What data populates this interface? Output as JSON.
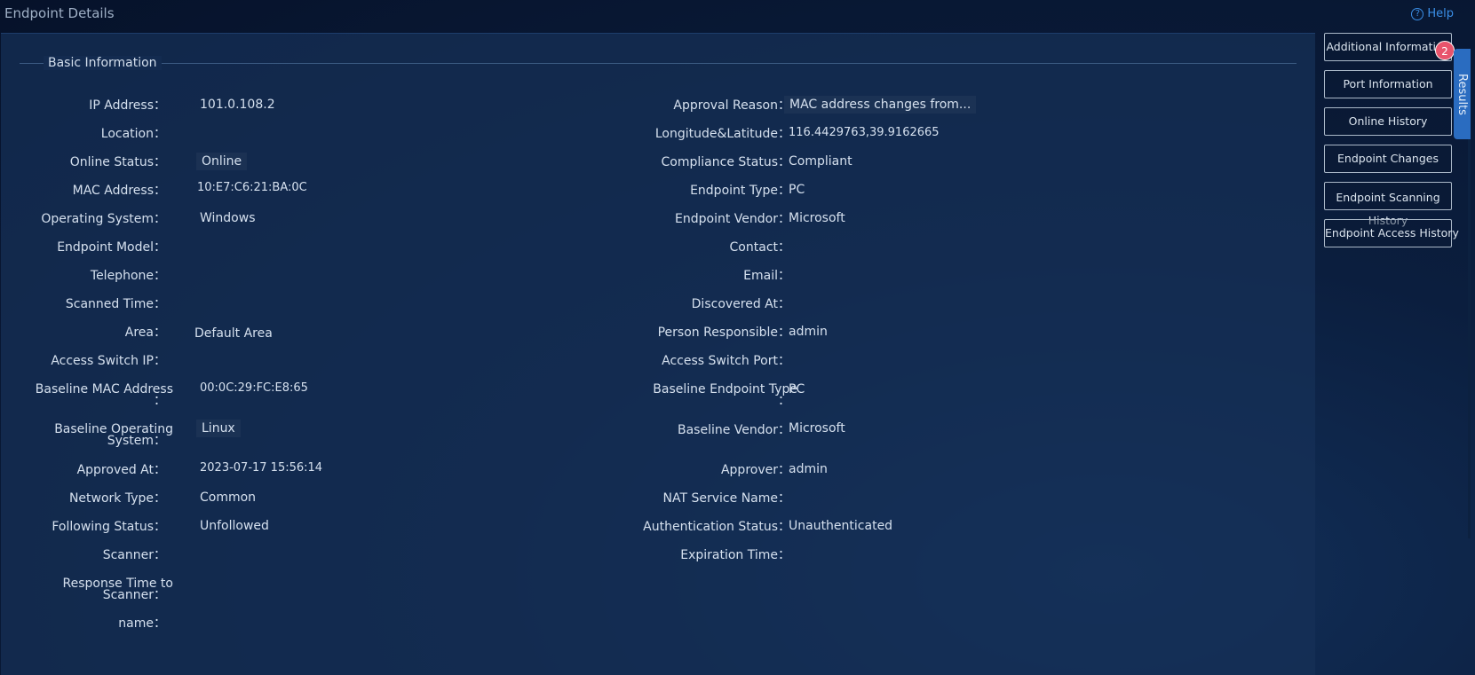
{
  "header": {
    "title": "Endpoint Details",
    "help_label": "Help",
    "help_icon": "question-circle-icon"
  },
  "section": {
    "title": "Basic Information"
  },
  "left_fields": [
    {
      "label": "IP Address：",
      "value": "101.0.108.2"
    },
    {
      "label": "Location：",
      "value": ""
    },
    {
      "label": "Online Status：",
      "value": "Online"
    },
    {
      "label": "MAC Address：",
      "value": "10:E7:C6:21:BA:0C"
    },
    {
      "label": "Operating System：",
      "value": "Windows"
    },
    {
      "label": "Endpoint Model：",
      "value": ""
    },
    {
      "label": "Telephone：",
      "value": ""
    },
    {
      "label": "Scanned Time：",
      "value": ""
    },
    {
      "label": "Area：",
      "value": "Default Area"
    },
    {
      "label": "Access Switch IP：",
      "value": ""
    },
    {
      "label_line1": "Baseline MAC Address",
      "label_line2": "：",
      "value": "00:0C:29:FC:E8:65"
    },
    {
      "label_line1": "Baseline Operating",
      "label_line2": "System：",
      "value": "Linux"
    },
    {
      "label": "Approved At：",
      "value": "2023-07-17 15:56:14"
    },
    {
      "label": "Network Type：",
      "value": "Common"
    },
    {
      "label": "Following Status：",
      "value": "Unfollowed"
    },
    {
      "label": "Scanner：",
      "value": ""
    },
    {
      "label_line1": "Response Time to",
      "label_line2": "Scanner：",
      "value": ""
    },
    {
      "label": "name：",
      "value": ""
    }
  ],
  "right_fields": [
    {
      "label": "Approval Reason：",
      "value": "MAC address changes from..."
    },
    {
      "label": "Longitude&Latitude：",
      "value": "116.4429763,39.9162665"
    },
    {
      "label": "Compliance Status：",
      "value": "Compliant"
    },
    {
      "label": "Endpoint Type：",
      "value": "PC"
    },
    {
      "label": "Endpoint Vendor：",
      "value": "Microsoft"
    },
    {
      "label": "Contact：",
      "value": ""
    },
    {
      "label": "Email：",
      "value": ""
    },
    {
      "label": "Discovered At：",
      "value": ""
    },
    {
      "label": "Person Responsible：",
      "value": "admin"
    },
    {
      "label": "Access Switch Port：",
      "value": ""
    },
    {
      "label_line1": "Baseline Endpoint Type",
      "label_line2": "：",
      "value": "PC"
    },
    {
      "label": "Baseline Vendor：",
      "value": "Microsoft"
    },
    {
      "label": "Approver：",
      "value": "admin"
    },
    {
      "label": "NAT Service Name：",
      "value": ""
    },
    {
      "label": "Authentication Status：",
      "value": "Unauthenticated"
    },
    {
      "label": "Expiration Time：",
      "value": ""
    }
  ],
  "sidebar": {
    "buttons": [
      {
        "label": "Additional Information"
      },
      {
        "label": "Port Information"
      },
      {
        "label": "Online History"
      },
      {
        "label": "Endpoint Changes"
      },
      {
        "label_line1": "Endpoint Scanning",
        "label_line2": "History"
      },
      {
        "label": "Endpoint Access History"
      }
    ],
    "badge_count": "2",
    "results_tab_label": "Results"
  },
  "colors": {
    "accent": "#3a8ee6",
    "badge": "#e8546c",
    "results_tab": "#2a6cc0"
  }
}
